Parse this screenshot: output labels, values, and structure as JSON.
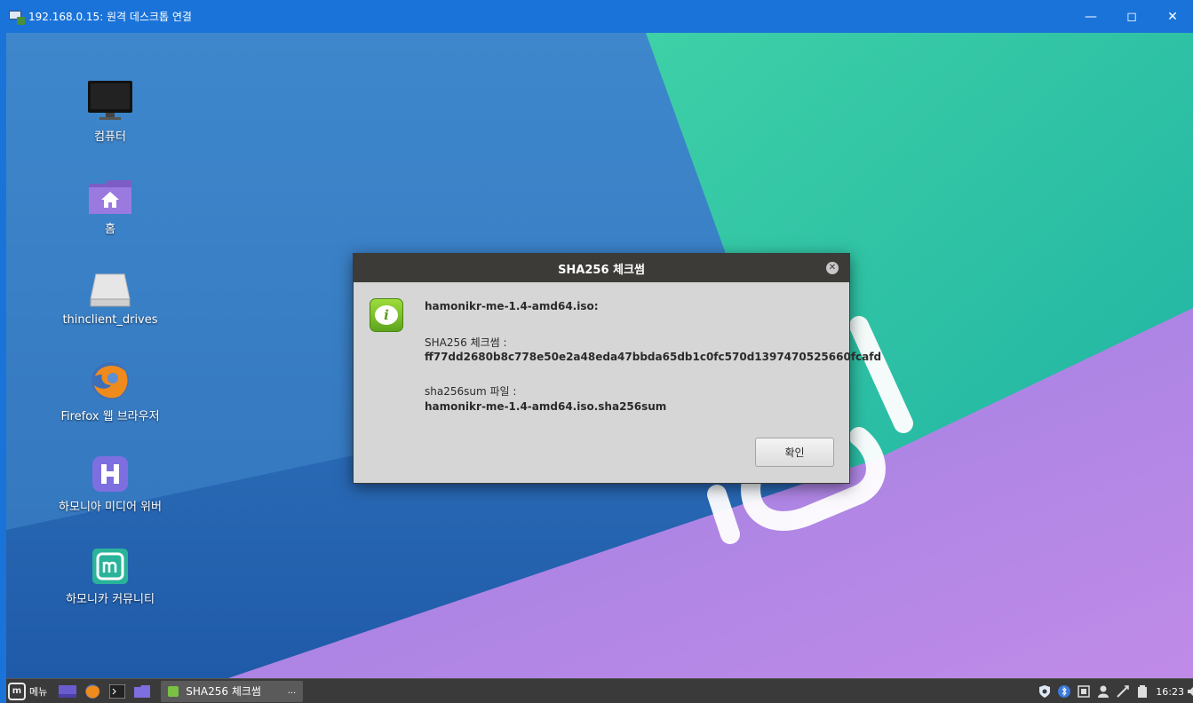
{
  "window": {
    "title": "192.168.0.15: 원격 데스크톱 연결",
    "controls": [
      "minimize",
      "maximize",
      "close"
    ]
  },
  "desktop_icons": [
    {
      "label": "컴퓨터",
      "icon": "monitor-icon"
    },
    {
      "label": "홈",
      "icon": "home-folder-icon"
    },
    {
      "label": "thinclient_drives",
      "icon": "drive-icon"
    },
    {
      "label": "Firefox 웹 브라우저",
      "icon": "firefox-icon"
    },
    {
      "label": "하모니아 미디어 위버",
      "icon": "media-weaver-icon"
    },
    {
      "label": "하모니카 커뮤니티",
      "icon": "hamonikr-community-icon"
    }
  ],
  "dialog": {
    "title": "SHA256 체크썸",
    "filename": "hamonikr-me-1.4-amd64.iso:",
    "checksum_label": "SHA256 체크썸 :",
    "checksum_value": "ff77dd2680b8c778e50e2a48eda47bbda65db1c0fc570d1397470525660fcafd",
    "sumfile_label": "sha256sum 파일 :",
    "sumfile_value": "hamonikr-me-1.4-amd64.iso.sha256sum",
    "ok_label": "확인"
  },
  "taskbar": {
    "menu_label": "메뉴",
    "active_task": "SHA256 체크썸",
    "task_more": "...",
    "clock": "16:23"
  },
  "colors": {
    "rdp_titlebar": "#1a73d9",
    "dialog_header": "#3c3b37",
    "dialog_body": "#d6d6d6",
    "taskbar": "#3a3a3a",
    "teal_wallpaper": "#2ec4a4",
    "purple_wallpaper": "#b98ae6"
  }
}
